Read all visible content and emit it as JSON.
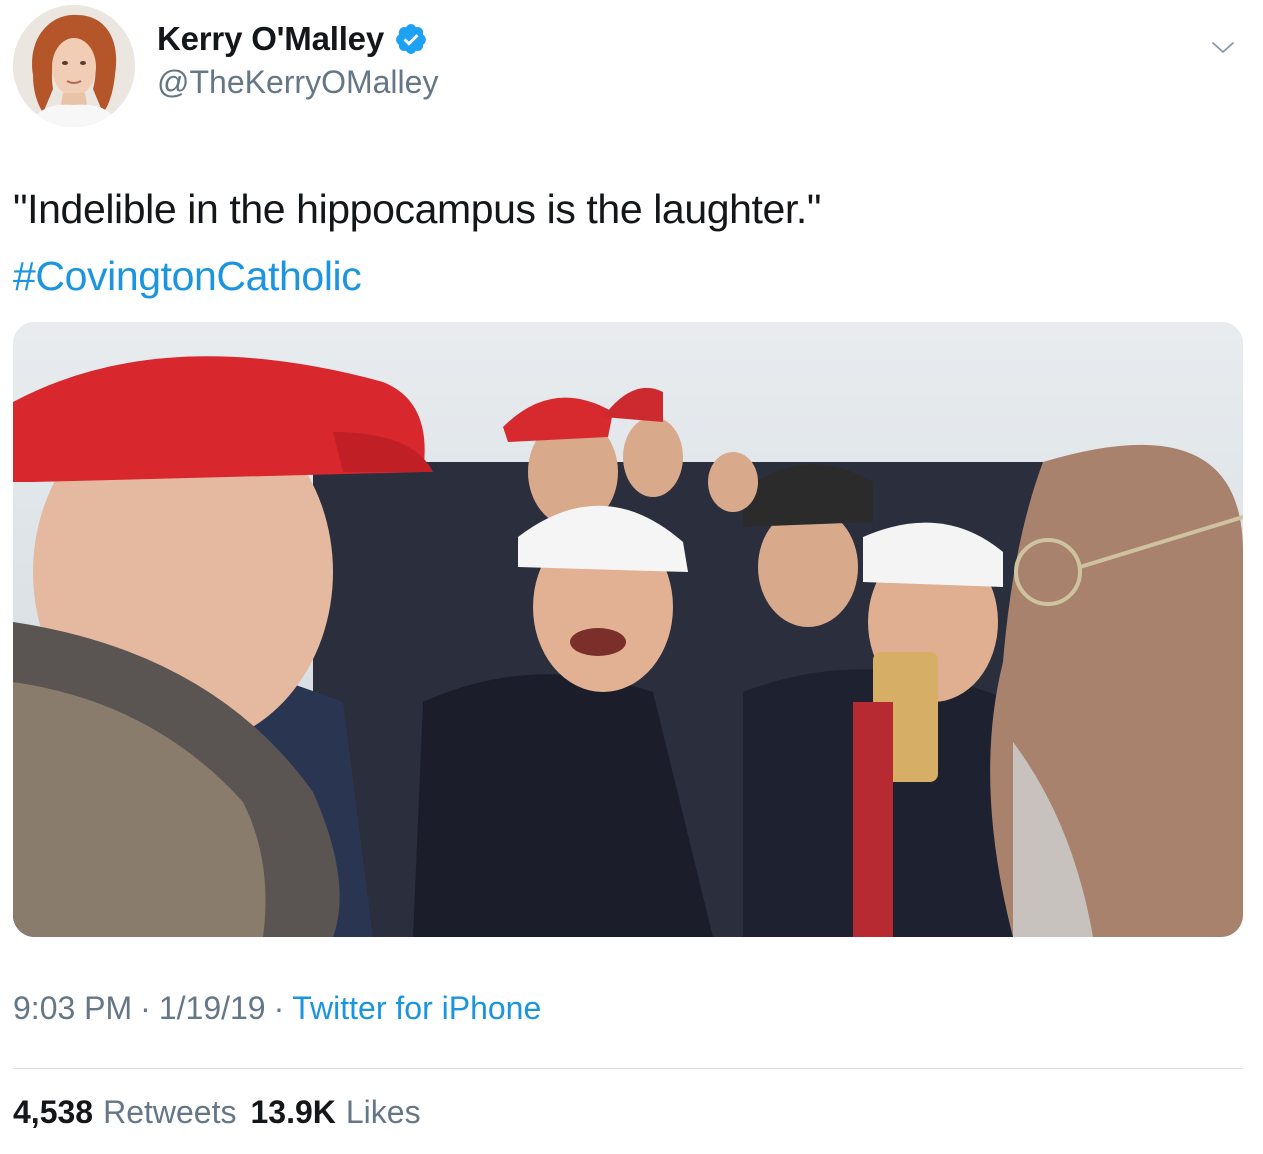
{
  "author": {
    "display_name": "Kerry O'Malley",
    "handle": "@TheKerryOMalley",
    "verified": true,
    "avatar_icon": "profile-photo"
  },
  "tweet": {
    "text": "\"Indelible in the hippocampus is the laughter.\"",
    "hashtag": "#CovingtonCatholic"
  },
  "media": {
    "image_label": "photo of crowd of teenagers in caps laughing"
  },
  "meta": {
    "time": "9:03 PM",
    "date": "1/19/19",
    "separator": "·",
    "source": "Twitter for iPhone"
  },
  "stats": {
    "retweets_count": "4,538",
    "retweets_label": "Retweets",
    "likes_count": "13.9K",
    "likes_label": "Likes"
  },
  "colors": {
    "link": "#1b95e0",
    "secondary_text": "#657786",
    "primary_text": "#14171a",
    "verified_badge": "#1da1f2"
  },
  "icons": {
    "verified": "verified-badge-icon",
    "more": "chevron-down-icon"
  }
}
